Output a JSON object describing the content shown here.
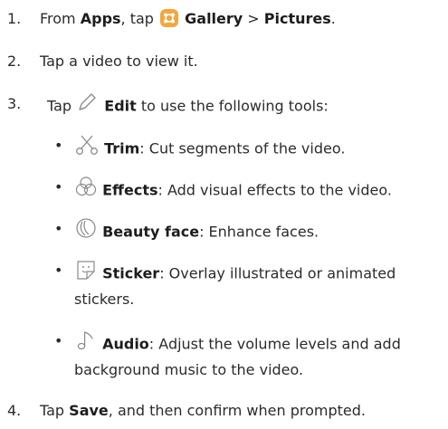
{
  "steps": [
    {
      "number": "1.",
      "prefix": "From ",
      "apps": "Apps",
      "mid": ", tap ",
      "gallery": "Gallery",
      "sep": " > ",
      "pictures": "Pictures",
      "end": "."
    },
    {
      "number": "2.",
      "text": "Tap a video to view it."
    },
    {
      "number": "3.",
      "prefix": "Tap ",
      "edit": "Edit",
      "suffix": " to use the following tools:"
    },
    {
      "number": "4.",
      "prefix": "Tap ",
      "save": "Save",
      "suffix": ", and then confirm when prompted."
    }
  ],
  "tools": [
    {
      "icon": "scissors-icon",
      "name": "Trim",
      "desc": ": Cut segments of the video."
    },
    {
      "icon": "effects-icon",
      "name": "Effects",
      "desc": ": Add visual effects to the video."
    },
    {
      "icon": "beauty-face-icon",
      "name": "Beauty face",
      "desc": ": Enhance faces."
    },
    {
      "icon": "sticker-icon",
      "name": "Sticker",
      "desc": ": Overlay illustrated or animated",
      "desc_cont": "stickers."
    },
    {
      "icon": "audio-icon",
      "name": "Audio",
      "desc": ": Adjust the volume levels and add",
      "desc_cont": "background music to the video."
    }
  ],
  "bullet_char": "•",
  "colors": {
    "text": "#2b2b2b",
    "gallery_icon": "#f3a73b",
    "icon_stroke": "#8a8a8a"
  }
}
